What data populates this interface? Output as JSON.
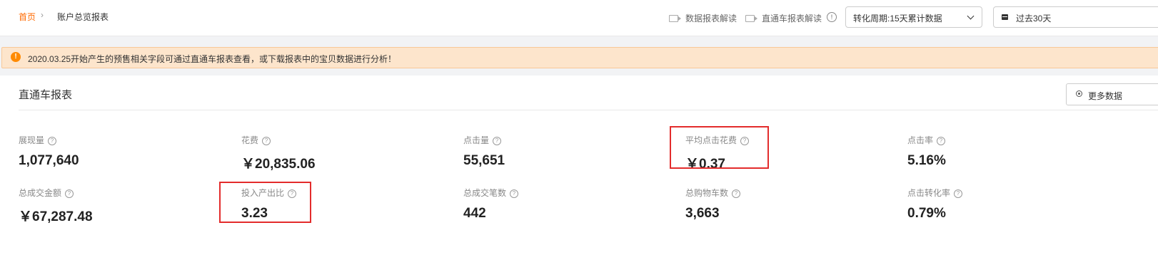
{
  "breadcrumb": {
    "home": "首页",
    "separator": "›",
    "current": "账户总览报表"
  },
  "toolbar": {
    "data_report_guide": "数据报表解读",
    "zhitongche_guide": "直通车报表解读",
    "info_glyph": "!",
    "period_select": "转化周期:15天累计数据",
    "date_select": "过去30天"
  },
  "notice": {
    "icon": "!",
    "text": "2020.03.25开始产生的预售相关字段可通过直通车报表查看，或下载报表中的宝贝数据进行分析！"
  },
  "panel": {
    "title": "直通车报表",
    "more_button": "更多数据"
  },
  "help_glyph": "?",
  "metrics": [
    {
      "label": "展现量",
      "value": "1,077,640"
    },
    {
      "label": "花费",
      "value": "￥20,835.06"
    },
    {
      "label": "点击量",
      "value": "55,651"
    },
    {
      "label": "平均点击花费",
      "value": "￥0.37"
    },
    {
      "label": "点击率",
      "value": "5.16%"
    },
    {
      "label": "总成交金额",
      "value": "￥67,287.48"
    },
    {
      "label": "投入产出比",
      "value": "3.23"
    },
    {
      "label": "总成交笔数",
      "value": "442"
    },
    {
      "label": "总购物车数",
      "value": "3,663"
    },
    {
      "label": "点击转化率",
      "value": "0.79%"
    }
  ],
  "colors": {
    "accent": "#ff6a00",
    "notice_bg": "#fde5cc",
    "highlight_box": "#e32c2c"
  }
}
